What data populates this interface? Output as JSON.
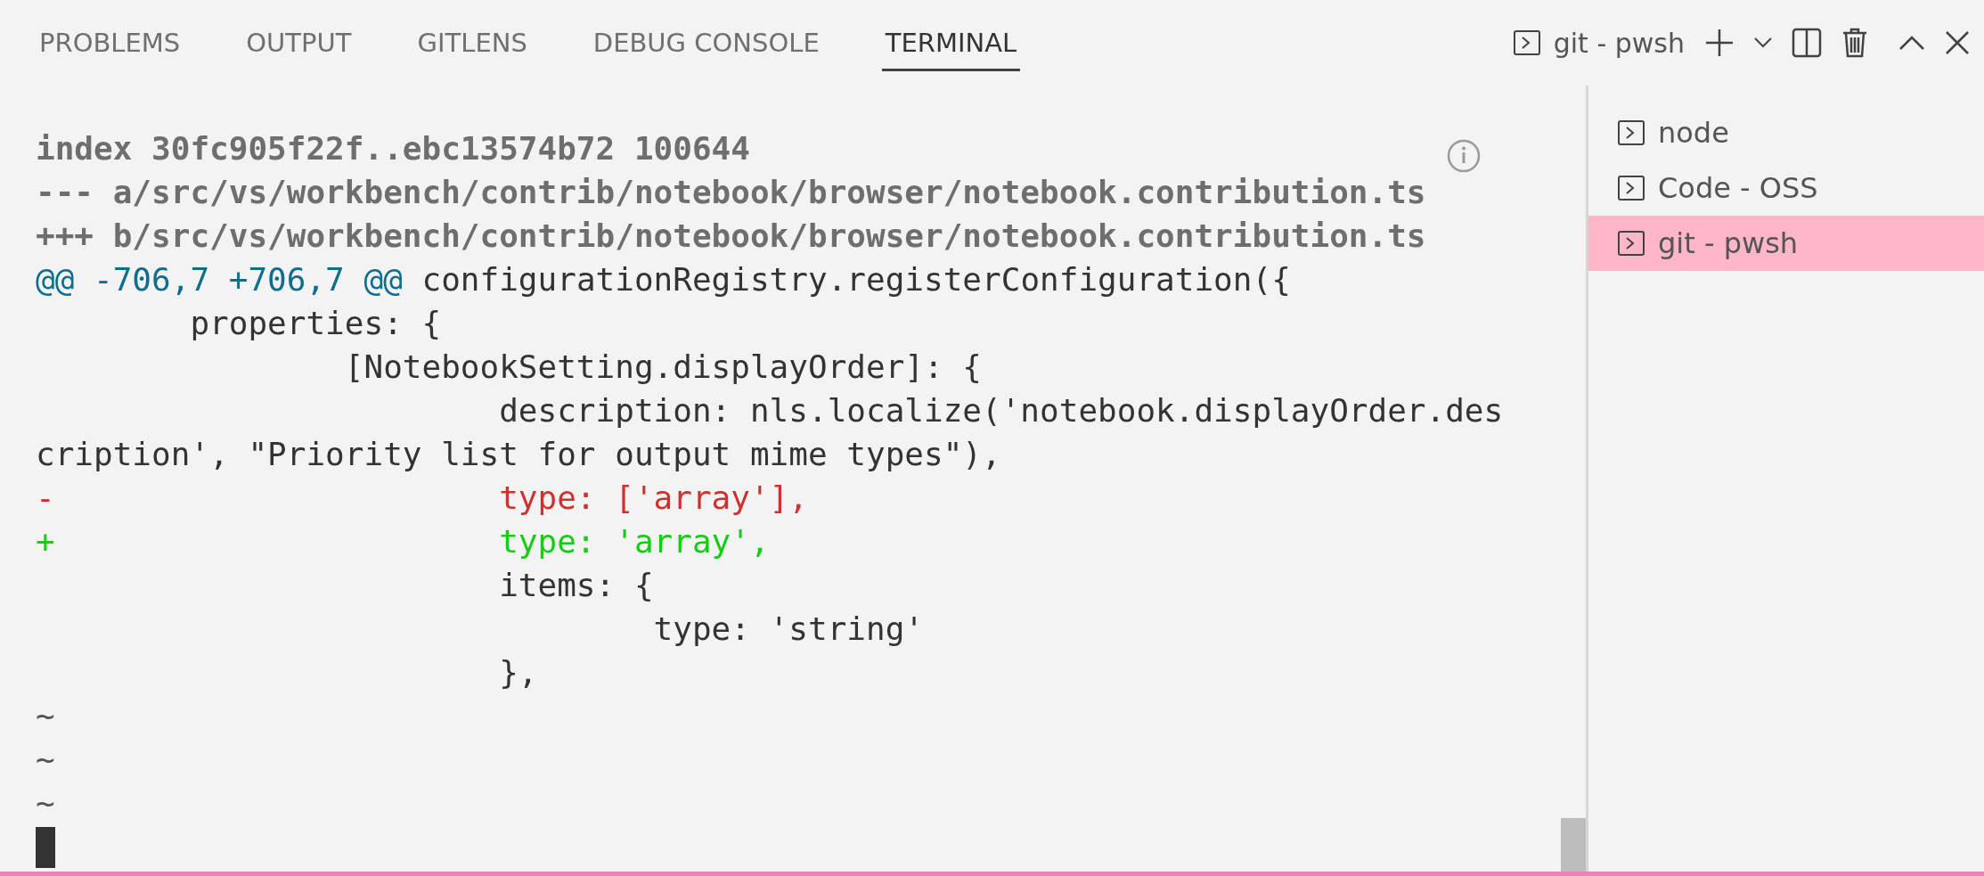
{
  "tabs": [
    {
      "label": "PROBLEMS",
      "selected": false
    },
    {
      "label": "OUTPUT",
      "selected": false
    },
    {
      "label": "GITLENS",
      "selected": false
    },
    {
      "label": "DEBUG CONSOLE",
      "selected": false
    },
    {
      "label": "TERMINAL",
      "selected": true
    }
  ],
  "toolbar": {
    "terminal_label": "git - pwsh"
  },
  "terminal": {
    "lines": [
      {
        "kind": "header",
        "text": "index 30fc905f22f..ebc13574b72 100644"
      },
      {
        "kind": "header",
        "text": "--- a/src/vs/workbench/contrib/notebook/browser/notebook.contribution.ts"
      },
      {
        "kind": "header",
        "text": "+++ b/src/vs/workbench/contrib/notebook/browser/notebook.contribution.ts"
      },
      {
        "kind": "hunk",
        "range": "@@ -706,7 +706,7 @@",
        "text": " configurationRegistry.registerConfiguration({"
      },
      {
        "kind": "context",
        "text": "        properties: {"
      },
      {
        "kind": "context",
        "text": "                [NotebookSetting.displayOrder]: {"
      },
      {
        "kind": "context",
        "text": "                        description: nls.localize('notebook.displayOrder.des"
      },
      {
        "kind": "context",
        "text": "cription', \"Priority list for output mime types\"),"
      },
      {
        "kind": "removed",
        "text": "-                       type: ['array'],"
      },
      {
        "kind": "added",
        "text": "+                       type: 'array',"
      },
      {
        "kind": "context",
        "text": "                        items: {"
      },
      {
        "kind": "context",
        "text": "                                type: 'string'"
      },
      {
        "kind": "context",
        "text": "                        },"
      },
      {
        "kind": "tilde",
        "text": "~"
      },
      {
        "kind": "tilde",
        "text": "~"
      },
      {
        "kind": "tilde",
        "text": "~"
      }
    ]
  },
  "terminals": [
    {
      "label": "node",
      "selected": false
    },
    {
      "label": "Code - OSS",
      "selected": false
    },
    {
      "label": "git - pwsh",
      "selected": true
    }
  ]
}
